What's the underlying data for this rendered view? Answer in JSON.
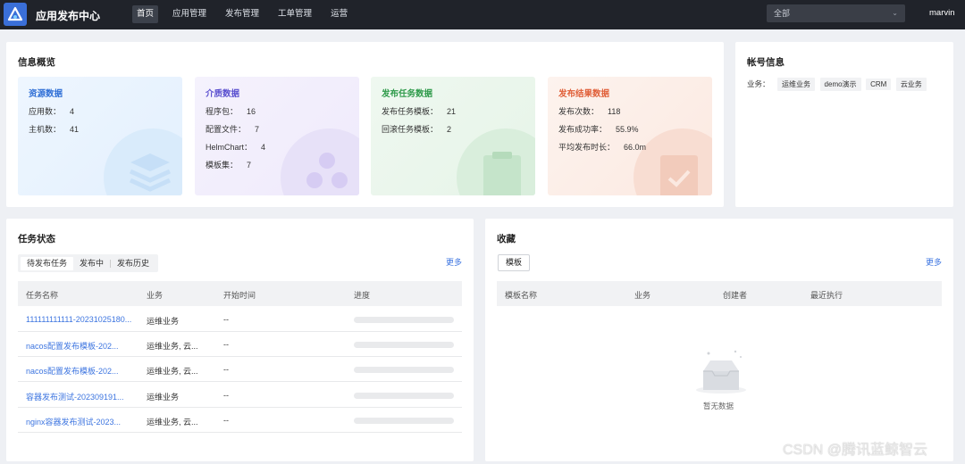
{
  "header": {
    "app_title": "应用发布中心",
    "logo_icon": "logo-icon",
    "nav": [
      {
        "label": "首页",
        "active": true
      },
      {
        "label": "应用管理",
        "active": false
      },
      {
        "label": "发布管理",
        "active": false
      },
      {
        "label": "工单管理",
        "active": false
      },
      {
        "label": "运营",
        "active": false
      }
    ],
    "business_select": "全部",
    "user": "marvin"
  },
  "overview": {
    "title": "信息概览",
    "cards": [
      {
        "title": "资源数据",
        "color": "#2f6fd6",
        "bg": "#e8f3fe",
        "rows": [
          {
            "key": "应用数：",
            "value": "4"
          },
          {
            "key": "主机数：",
            "value": "41"
          }
        ]
      },
      {
        "title": "介质数据",
        "color": "#5a4fcf",
        "bg": "#f1eefb",
        "rows": [
          {
            "key": "程序包：",
            "value": "16"
          },
          {
            "key": "配置文件：",
            "value": "7"
          },
          {
            "key": "HelmChart：",
            "value": "4"
          },
          {
            "key": "模板集：",
            "value": "7"
          }
        ]
      },
      {
        "title": "发布任务数据",
        "color": "#2e9a4a",
        "bg": "#eaf6ec",
        "rows": [
          {
            "key": "发布任务模板：",
            "value": "21"
          },
          {
            "key": "回滚任务模板：",
            "value": "2"
          }
        ]
      },
      {
        "title": "发布结果数据",
        "color": "#e0603a",
        "bg": "#fdf0ea",
        "rows": [
          {
            "key": "发布次数：",
            "value": "118"
          },
          {
            "key": "发布成功率：",
            "value": "55.9%"
          },
          {
            "key": "平均发布时长：",
            "value": "66.0m"
          }
        ]
      }
    ]
  },
  "account": {
    "title": "帐号信息",
    "business_label": "业务：",
    "tags": [
      "运维业务",
      "demo演示",
      "CRM",
      "云业务"
    ]
  },
  "tasks": {
    "title": "任务状态",
    "tabs": [
      "待发布任务",
      "发布中",
      "发布历史"
    ],
    "more": "更多",
    "columns": [
      "任务名称",
      "业务",
      "开始时间",
      "进度"
    ],
    "rows": [
      {
        "name": "111111111111-20231025180...",
        "biz": "运维业务",
        "start": "--",
        "progress": 0
      },
      {
        "name": "nacos配置发布模板-202...",
        "biz": "运维业务, 云...",
        "start": "--",
        "progress": 0
      },
      {
        "name": "nacos配置发布模板-202...",
        "biz": "运维业务, 云...",
        "start": "--",
        "progress": 0
      },
      {
        "name": "容器发布测试-202309191...",
        "biz": "运维业务",
        "start": "--",
        "progress": 0
      },
      {
        "name": "nginx容器发布测试-2023...",
        "biz": "运维业务, 云...",
        "start": "--",
        "progress": 0
      }
    ]
  },
  "favorites": {
    "title": "收藏",
    "tab": "模板",
    "more": "更多",
    "columns": [
      "模板名称",
      "业务",
      "创建者",
      "最近执行"
    ],
    "empty_text": "暂无数据"
  },
  "watermark": "CSDN @腾讯蓝鲸智云"
}
